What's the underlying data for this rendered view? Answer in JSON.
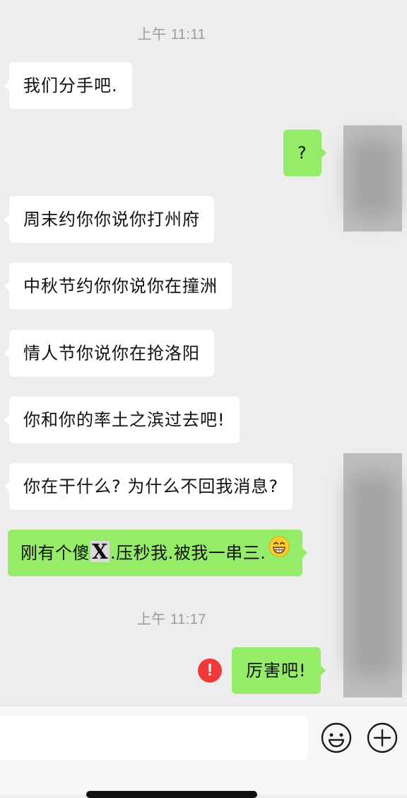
{
  "chat": {
    "timestamps": [
      "上午 11:11",
      "上午 11:17"
    ],
    "messages": [
      {
        "side": "in",
        "text": "我们分手吧."
      },
      {
        "side": "out",
        "text": "?"
      },
      {
        "side": "in",
        "text": "周末约你你说你打州府"
      },
      {
        "side": "in",
        "text": "中秋节约你你说你在撞洲"
      },
      {
        "side": "in",
        "text": "情人节你说你在抢洛阳"
      },
      {
        "side": "in",
        "text": "你和你的率土之滨过去吧!"
      },
      {
        "side": "in",
        "text": "你在干什么? 为什么不回我消息?"
      },
      {
        "side": "out",
        "text_before": "刚有个傻",
        "text_mark": "X",
        "text_after": ".压秒我.被我一串三.",
        "emoji": "grinning-face-icon"
      },
      {
        "side": "out",
        "text": "厉害吧!",
        "status": "failed"
      }
    ],
    "failed_badge": "!"
  },
  "input_bar": {
    "placeholder": "",
    "icons": [
      "emoji-icon",
      "plus-icon"
    ]
  },
  "colors": {
    "background": "#ededed",
    "incoming_bubble": "#ffffff",
    "outgoing_bubble": "#95ec69",
    "timestamp_text": "#9b9b9b",
    "error_badge": "#f03a3a"
  }
}
